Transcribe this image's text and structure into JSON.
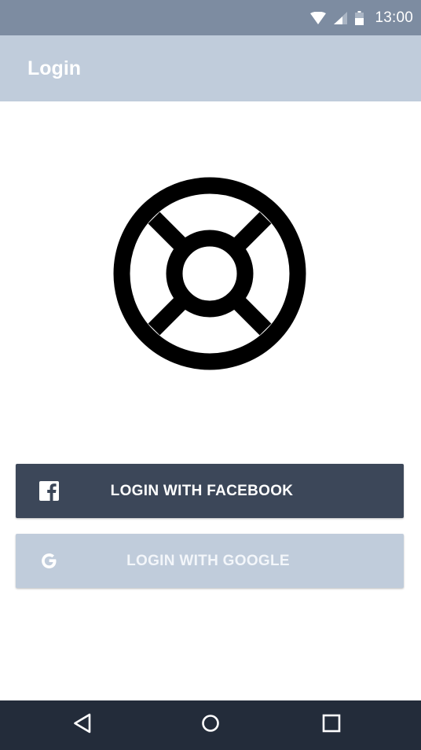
{
  "status_bar": {
    "time": "13:00",
    "icons": [
      "wifi-icon",
      "cell-signal-icon",
      "battery-icon"
    ]
  },
  "app_bar": {
    "title": "Login"
  },
  "logo": {
    "icon": "lifebuoy-icon"
  },
  "buttons": {
    "facebook": {
      "label": "LOGIN WITH FACEBOOK",
      "icon": "facebook-icon"
    },
    "google": {
      "label": "LOGIN WITH GOOGLE",
      "icon": "google-icon"
    }
  },
  "nav_bar": {
    "icons": [
      "back-icon",
      "home-icon",
      "recents-icon"
    ]
  },
  "colors": {
    "status_bar": "#7d8ca1",
    "app_bar": "#c0ccdb",
    "facebook_button": "#3c4759",
    "google_button": "#c0ccdb",
    "nav_bar": "#232c3a"
  }
}
